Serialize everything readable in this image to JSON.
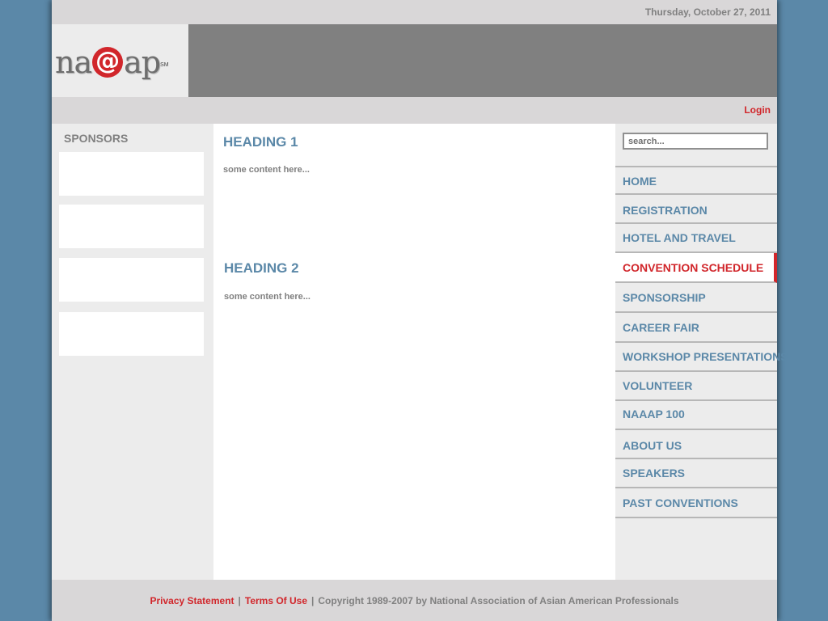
{
  "header": {
    "date": "Thursday, October 27, 2011",
    "logo": {
      "prefix": "na",
      "at": "@",
      "suffix": "ap",
      "mark": "SM"
    },
    "login_label": "Login"
  },
  "sidebar_left": {
    "title": "SPONSORS",
    "slot_count": 4
  },
  "main": {
    "sections": [
      {
        "heading": "HEADING 1",
        "text": "some content here..."
      },
      {
        "heading": "HEADING 2",
        "text": "some content here..."
      }
    ]
  },
  "sidebar_right": {
    "search_placeholder": "search...",
    "nav": [
      {
        "label": "HOME",
        "active": false
      },
      {
        "label": "REGISTRATION",
        "active": false
      },
      {
        "label": "HOTEL AND TRAVEL",
        "active": false
      },
      {
        "label": "CONVENTION SCHEDULE",
        "active": true
      },
      {
        "label": "SPONSORSHIP",
        "active": false
      },
      {
        "label": "CAREER FAIR",
        "active": false
      },
      {
        "label": "WORKSHOP PRESENTATIONS",
        "active": false
      },
      {
        "label": "VOLUNTEER",
        "active": false
      },
      {
        "label": "NAAAP 100",
        "active": false
      },
      {
        "label": "ABOUT US",
        "active": false
      },
      {
        "label": "SPEAKERS",
        "active": false
      },
      {
        "label": "PAST CONVENTIONS",
        "active": false
      }
    ]
  },
  "footer": {
    "privacy_label": "Privacy Statement",
    "separator": "|",
    "terms_label": "Terms Of Use",
    "copyright": "Copyright 1989-2007 by National Association of Asian American Professionals"
  },
  "colors": {
    "background": "#5b88a8",
    "accent_red": "#d1262b",
    "nav_blue": "#5b88a8",
    "banner_gray": "#808080",
    "bar_gray": "#d9d7d8",
    "panel_gray": "#ececec"
  }
}
